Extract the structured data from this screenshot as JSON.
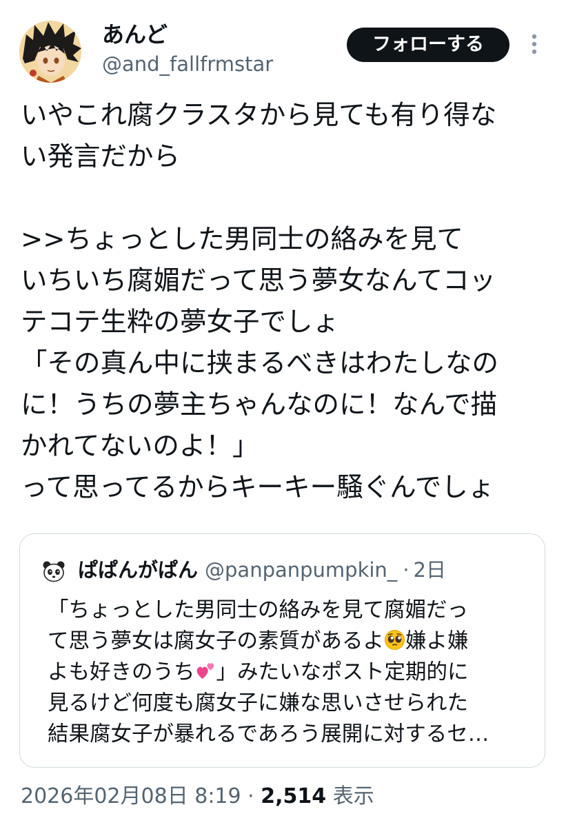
{
  "author": {
    "display_name": "あんど",
    "handle": "@and_fallfrmstar",
    "avatar_icon": "anime-character-avatar"
  },
  "follow_label": "フォローする",
  "more_icon": "more-vertical-icon",
  "tweet_lines": [
    "いやこれ腐クラスタから見ても有り得な",
    "い発言だから",
    "",
    ">>ちょっとした男同士の絡みを見て",
    "いちいち腐媚だって思う夢女なんてコッ",
    "テコテ生粋の夢女子でしょ",
    "「その真ん中に挟まるべきはわたしなの",
    "に！うちの夢主ちゃんなのに！なんで描",
    "かれてないのよ！」",
    "って思ってるからキーキー騒ぐんでしょ"
  ],
  "quote": {
    "avatar_icon": "panda-icon",
    "display_name": "ぱぱんがぱん",
    "handle": "@panpanpumpkin_",
    "separator": "·",
    "time": "2日",
    "lines": [
      {
        "text": "「ちょっとした男同士の絡みを見て腐媚だっ"
      },
      {
        "text": "て思う夢女は腐女子の素質があるよ",
        "emoji": "pleading-face-emoji",
        "after": "嫌よ嫌"
      },
      {
        "text": "よも好きのうち",
        "emoji": "two-hearts-emoji",
        "after": "」みたいなポスト定期的に"
      },
      {
        "text": "見るけど何度も腐女子に嫌な思いさせられた"
      },
      {
        "text": "結果腐女子が暴れるであろう展開に対するセ…"
      }
    ]
  },
  "meta": {
    "timestamp": "2026年02月08日 8:19",
    "separator": "·",
    "views_count": "2,514",
    "views_label": "表示"
  }
}
